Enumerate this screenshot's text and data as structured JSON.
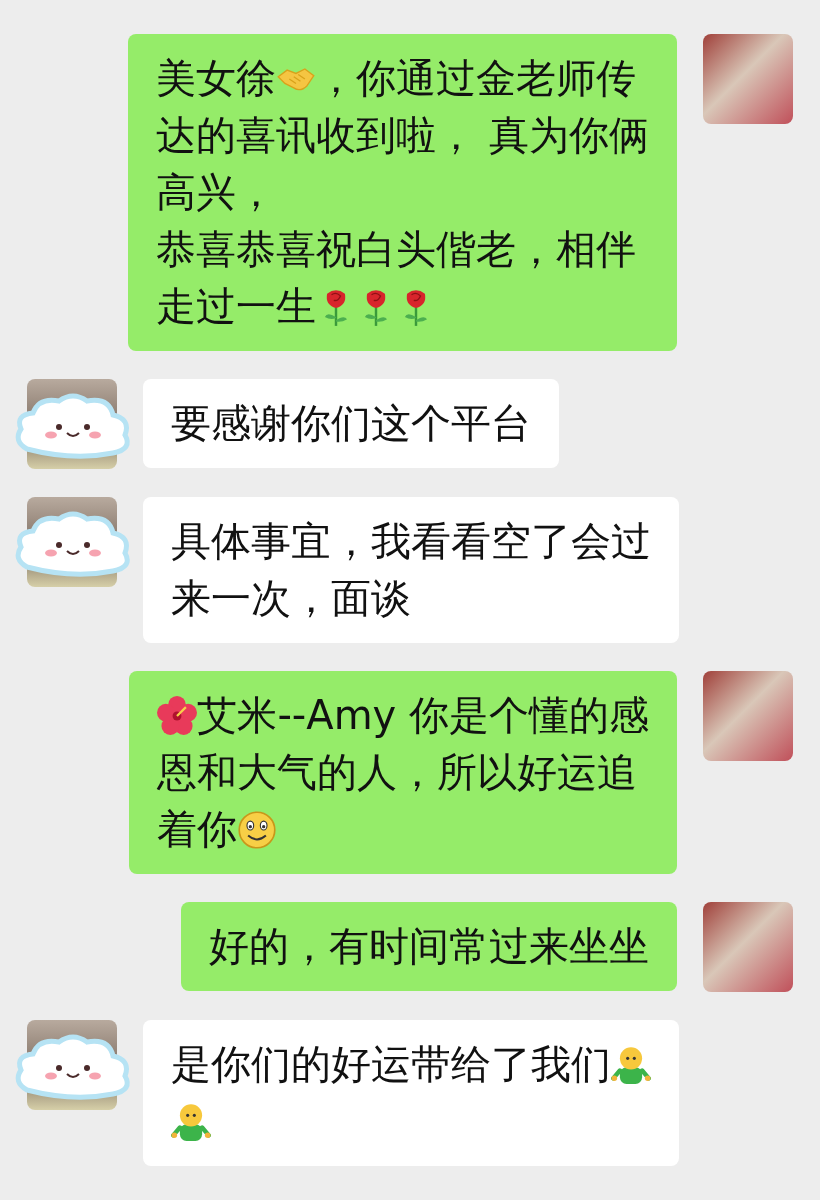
{
  "messages": [
    {
      "kind": "sent",
      "lines": [
        [
          {
            "kind": "text",
            "text": "美女徐"
          },
          {
            "kind": "handshake"
          },
          {
            "kind": "text",
            "text": "，你通过金老师传"
          }
        ],
        [
          {
            "kind": "text",
            "text": "达的喜讯收到啦， 真为你俩"
          }
        ],
        [
          {
            "kind": "text",
            "text": "高兴，"
          }
        ],
        [
          {
            "kind": "text",
            "text": "恭喜恭喜祝白头偕老，相伴"
          }
        ],
        [
          {
            "kind": "text",
            "text": "走过一生"
          },
          {
            "kind": "rose"
          },
          {
            "kind": "rose"
          },
          {
            "kind": "rose"
          }
        ]
      ]
    },
    {
      "kind": "received",
      "lines": [
        [
          {
            "kind": "text",
            "text": "要感谢你们这个平台"
          }
        ]
      ]
    },
    {
      "kind": "received",
      "lines": [
        [
          {
            "kind": "text",
            "text": "具体事宜，我看看空了会过"
          }
        ],
        [
          {
            "kind": "text",
            "text": "来一次，面谈"
          }
        ]
      ]
    },
    {
      "kind": "sent",
      "lines": [
        [
          {
            "kind": "hibiscus"
          },
          {
            "kind": "text",
            "text": "艾米--Amy 你是个懂的感"
          }
        ],
        [
          {
            "kind": "text",
            "text": "恩和大气的人，所以好运追"
          }
        ],
        [
          {
            "kind": "text",
            "text": "着你"
          },
          {
            "kind": "smile"
          }
        ]
      ]
    },
    {
      "kind": "sent",
      "lines": [
        [
          {
            "kind": "text",
            "text": "好的，有时间常过来坐坐"
          }
        ]
      ]
    },
    {
      "kind": "received",
      "lines": [
        [
          {
            "kind": "text",
            "text": "是你们的好运带给了我们"
          },
          {
            "kind": "hug"
          }
        ],
        [
          {
            "kind": "hug"
          }
        ]
      ]
    }
  ]
}
